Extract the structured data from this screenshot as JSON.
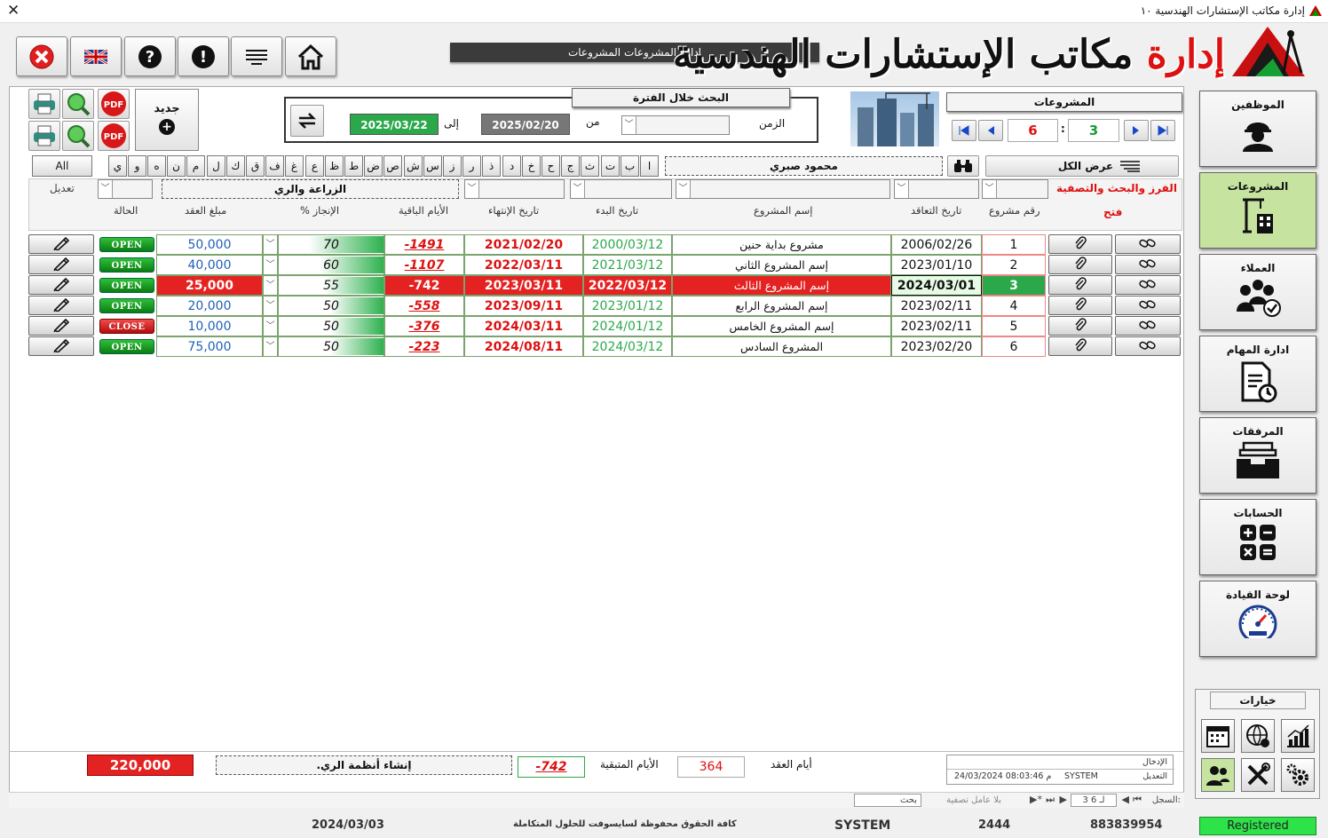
{
  "window": {
    "title": "إدارة مكاتب الإستشارات الهندسية ١٠",
    "close_glyph": "✕"
  },
  "header": {
    "section_title": "إدارة المشروعات المشروعات",
    "logo_red": "إدارة",
    "logo_black": "مكاتب الإستشارات الهندسية"
  },
  "toolbar": {
    "buttons": [
      "close",
      "language",
      "help",
      "info",
      "menu",
      "home"
    ]
  },
  "sidebar": {
    "items": [
      {
        "label": "الموظفين",
        "icon": "engineer-icon",
        "active": false
      },
      {
        "label": "المشروعات",
        "icon": "crane-building-icon",
        "active": true
      },
      {
        "label": "العملاء",
        "icon": "clients-icon",
        "active": false
      },
      {
        "label": "ادارة المهام",
        "icon": "tasks-icon",
        "active": false
      },
      {
        "label": "المرفقات",
        "icon": "inbox-icon",
        "active": false
      },
      {
        "label": "الحسابات",
        "icon": "calculator-icon",
        "active": false
      },
      {
        "label": "لوحة القيادة",
        "icon": "dashboard-gauge-icon",
        "active": false
      }
    ],
    "options_label": "خيارات"
  },
  "projects_panel": {
    "title": "المشروعات",
    "current": "3",
    "total": "6",
    "sep": ":"
  },
  "period": {
    "title": "البحث خلال الفترة",
    "time_label": "الزمن",
    "from_label": "من",
    "to_label": "إلى",
    "from_date": "2025/02/20",
    "to_date": "2025/03/22"
  },
  "new_button": {
    "label": "جديد",
    "plus": "+",
    "pdf": "PDF"
  },
  "filter": {
    "show_all": "عرض الكل",
    "search_value": "محمود صبري",
    "letters": [
      "ا",
      "ب",
      "ت",
      "ث",
      "ج",
      "ح",
      "خ",
      "د",
      "ذ",
      "ر",
      "ز",
      "س",
      "ش",
      "ص",
      "ض",
      "ط",
      "ظ",
      "ع",
      "غ",
      "ف",
      "ق",
      "ك",
      "ل",
      "م",
      "ن",
      "ه",
      "و",
      "ي"
    ],
    "all": "All",
    "sort_label": "الفرز والبحث والتصفية",
    "open_label": "فتح",
    "category_value": "الزراعة والري",
    "edit_label": "تعديل"
  },
  "columns": {
    "project_no": "رقم مشروع",
    "contract_date": "تاريخ التعاقد",
    "project_name": "إسم المشروع",
    "start_date": "تاريخ البدء",
    "end_date": "تاريخ الإنتهاء",
    "remaining_days": "الأيام الباقية",
    "progress": "الإنجاز %",
    "contract_amount": "مبلغ العقد",
    "status": "الحالة"
  },
  "rows": [
    {
      "no": "1",
      "contract_date": "2006/02/26",
      "name": "مشروع بداية حنين",
      "start": "2000/03/12",
      "end": "2021/02/20",
      "remaining": "-1491",
      "progress": "70",
      "amount": "50,000",
      "status": "OPEN",
      "selected": false
    },
    {
      "no": "2",
      "contract_date": "2023/01/10",
      "name": "إسم المشروع الثاني",
      "start": "2021/03/12",
      "end": "2022/03/11",
      "remaining": "-1107",
      "progress": "60",
      "amount": "40,000",
      "status": "OPEN",
      "selected": false
    },
    {
      "no": "3",
      "contract_date": "2024/03/01",
      "name": "إسم المشروع الثالث",
      "start": "2022/03/12",
      "end": "2023/03/11",
      "remaining": "-742",
      "progress": "55",
      "amount": "25,000",
      "status": "OPEN",
      "selected": true
    },
    {
      "no": "4",
      "contract_date": "2023/02/11",
      "name": "إسم المشروع الرابع",
      "start": "2023/01/12",
      "end": "2023/09/11",
      "remaining": "-558",
      "progress": "50",
      "amount": "20,000",
      "status": "OPEN",
      "selected": false
    },
    {
      "no": "5",
      "contract_date": "2023/02/11",
      "name": "إسم المشروع الخامس",
      "start": "2024/01/12",
      "end": "2024/03/11",
      "remaining": "-376",
      "progress": "50",
      "amount": "10,000",
      "status": "CLOSE",
      "selected": false
    },
    {
      "no": "6",
      "contract_date": "2023/02/20",
      "name": "المشروع السادس",
      "start": "2024/03/12",
      "end": "2024/08/11",
      "remaining": "-223",
      "progress": "50",
      "amount": "75,000",
      "status": "OPEN",
      "selected": false
    }
  ],
  "footer": {
    "total_amount": "220,000",
    "project_desc": "إنشاء أنظمة الري.",
    "remaining_value": "-742",
    "remaining_label": "الأيام المتبقية",
    "contract_days_value": "364",
    "contract_days_label": "أيام العقد",
    "entry_label": "الإدخال",
    "edit_label": "التعديل",
    "user": "SYSTEM",
    "timestamp": "24/03/2024 08:03:46 م"
  },
  "nav": {
    "record_label": "السجل:",
    "record": "3 لـ 6",
    "no_filter": "بلا عامل تصفية",
    "search": "بحث"
  },
  "status": {
    "phone": "883839954",
    "code": "2444",
    "user": "SYSTEM",
    "copyright": "كافة الحقوق محفوظة لسايسوفت للحلول المتكاملة",
    "date": "2024/03/03",
    "registered": "Registered"
  },
  "colors": {
    "open": "#0a7d12",
    "close": "#b30c0c",
    "selected_row": "#e52222",
    "accent_green": "#2aa84a"
  }
}
